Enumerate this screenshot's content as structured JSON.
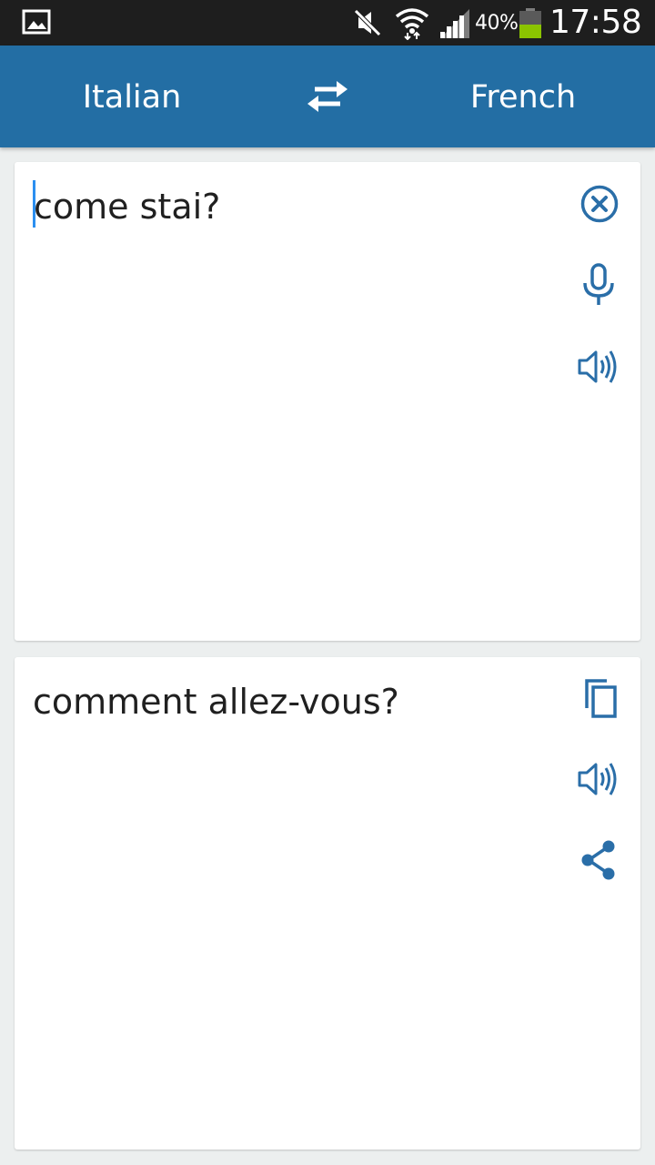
{
  "status_bar": {
    "battery_percent": "40%",
    "time": "17:58",
    "icons": [
      "gallery-icon",
      "mute-icon",
      "wifi-icon",
      "signal-icon",
      "battery-icon"
    ]
  },
  "toolbar": {
    "source_language": "Italian",
    "target_language": "French",
    "swap_icon": "swap-icon"
  },
  "input_card": {
    "text": "come stai?",
    "icons": [
      "clear-icon",
      "microphone-icon",
      "speaker-icon"
    ]
  },
  "output_card": {
    "text": "comment allez-vous?",
    "icons": [
      "copy-icon",
      "speaker-icon",
      "share-icon"
    ]
  },
  "colors": {
    "accent": "#236ea4",
    "icon": "#2a6ea8",
    "status_bar": "#1e1e1e",
    "background": "#ecefef",
    "caret": "#2b8ff0",
    "battery_fill": "#8bc400"
  }
}
